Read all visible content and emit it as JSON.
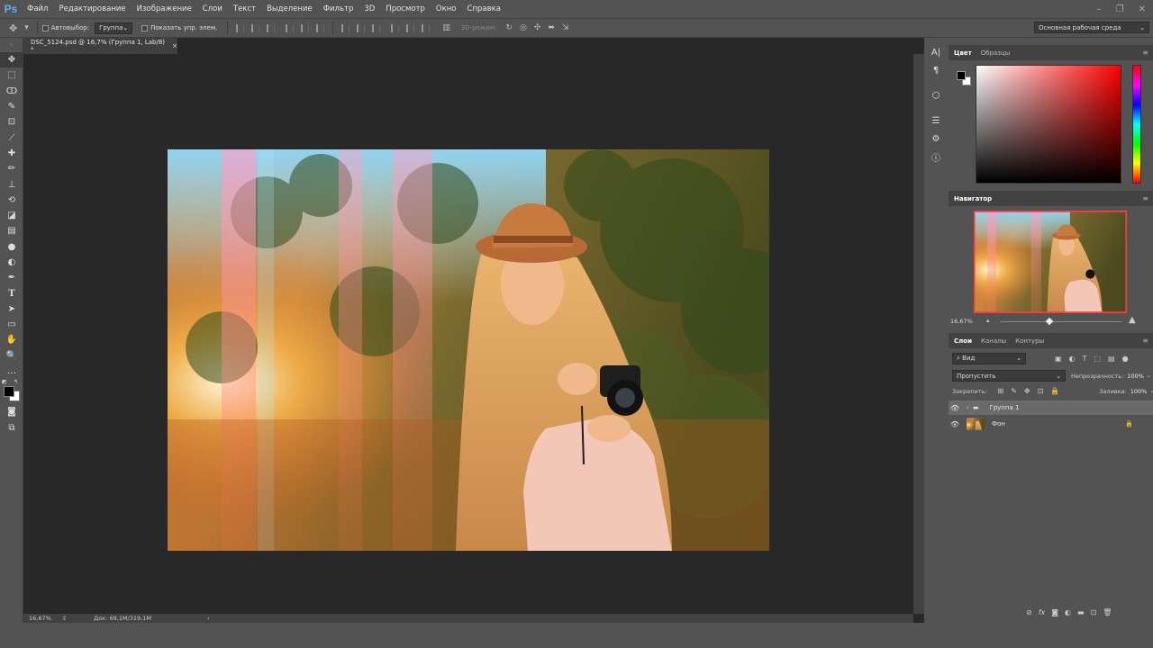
{
  "app": {
    "logo": "Ps"
  },
  "menu": [
    "Файл",
    "Редактирование",
    "Изображение",
    "Слои",
    "Текст",
    "Выделение",
    "Фильтр",
    "3D",
    "Просмотр",
    "Окно",
    "Справка"
  ],
  "window_controls": {
    "minimize": "–",
    "restore": "❐",
    "close": "✕"
  },
  "options": {
    "autoselect_label": "Автовыбор:",
    "autoselect_value": "Группа",
    "show_controls_label": "Показать упр. элем.",
    "mode3d_label": "3D-режим:",
    "workspace_value": "Основная рабочая среда"
  },
  "document": {
    "tab_title": "DSC_5124.psd @ 16,7% (Группа 1, Lab/8) *",
    "tab_close": "×",
    "zoom": "16,67%",
    "doc_size": "Док: 69,1M/319,1M",
    "status_arrow": "›"
  },
  "color_panel": {
    "tabs": [
      "Цвет",
      "Образцы"
    ],
    "active_tab": 0
  },
  "navigator": {
    "title": "Навигатор",
    "zoom": "16,67%",
    "zoom_fraction": 0.4
  },
  "layers_panel": {
    "tabs": [
      "Слои",
      "Каналы",
      "Контуры"
    ],
    "active_tab": 0,
    "filter_label": "Вид",
    "blend_mode": "Пропустить",
    "opacity_label": "Непрозрачность:",
    "opacity_value": "100%",
    "lock_label": "Закрепить:",
    "fill_label": "Заливка:",
    "fill_value": "100%",
    "layers": [
      {
        "name": "Группа 1",
        "type": "group",
        "selected": true,
        "visible": true
      },
      {
        "name": "Фон",
        "type": "background",
        "selected": false,
        "visible": true,
        "locked": true
      }
    ]
  },
  "colors": {
    "accent": "#5ab0ff",
    "fg": "#000000",
    "bg": "#ffffff"
  },
  "icons": {
    "tools": [
      "move-icon",
      "marquee-icon",
      "lasso-icon",
      "quick-select-icon",
      "crop-icon",
      "eyedropper-icon",
      "healing-icon",
      "brush-icon",
      "stamp-icon",
      "history-brush-icon",
      "eraser-icon",
      "gradient-icon",
      "blur-icon",
      "dodge-icon",
      "pen-icon",
      "type-icon",
      "path-select-icon",
      "rectangle-icon",
      "hand-icon",
      "zoom-icon",
      "more-icon"
    ]
  }
}
